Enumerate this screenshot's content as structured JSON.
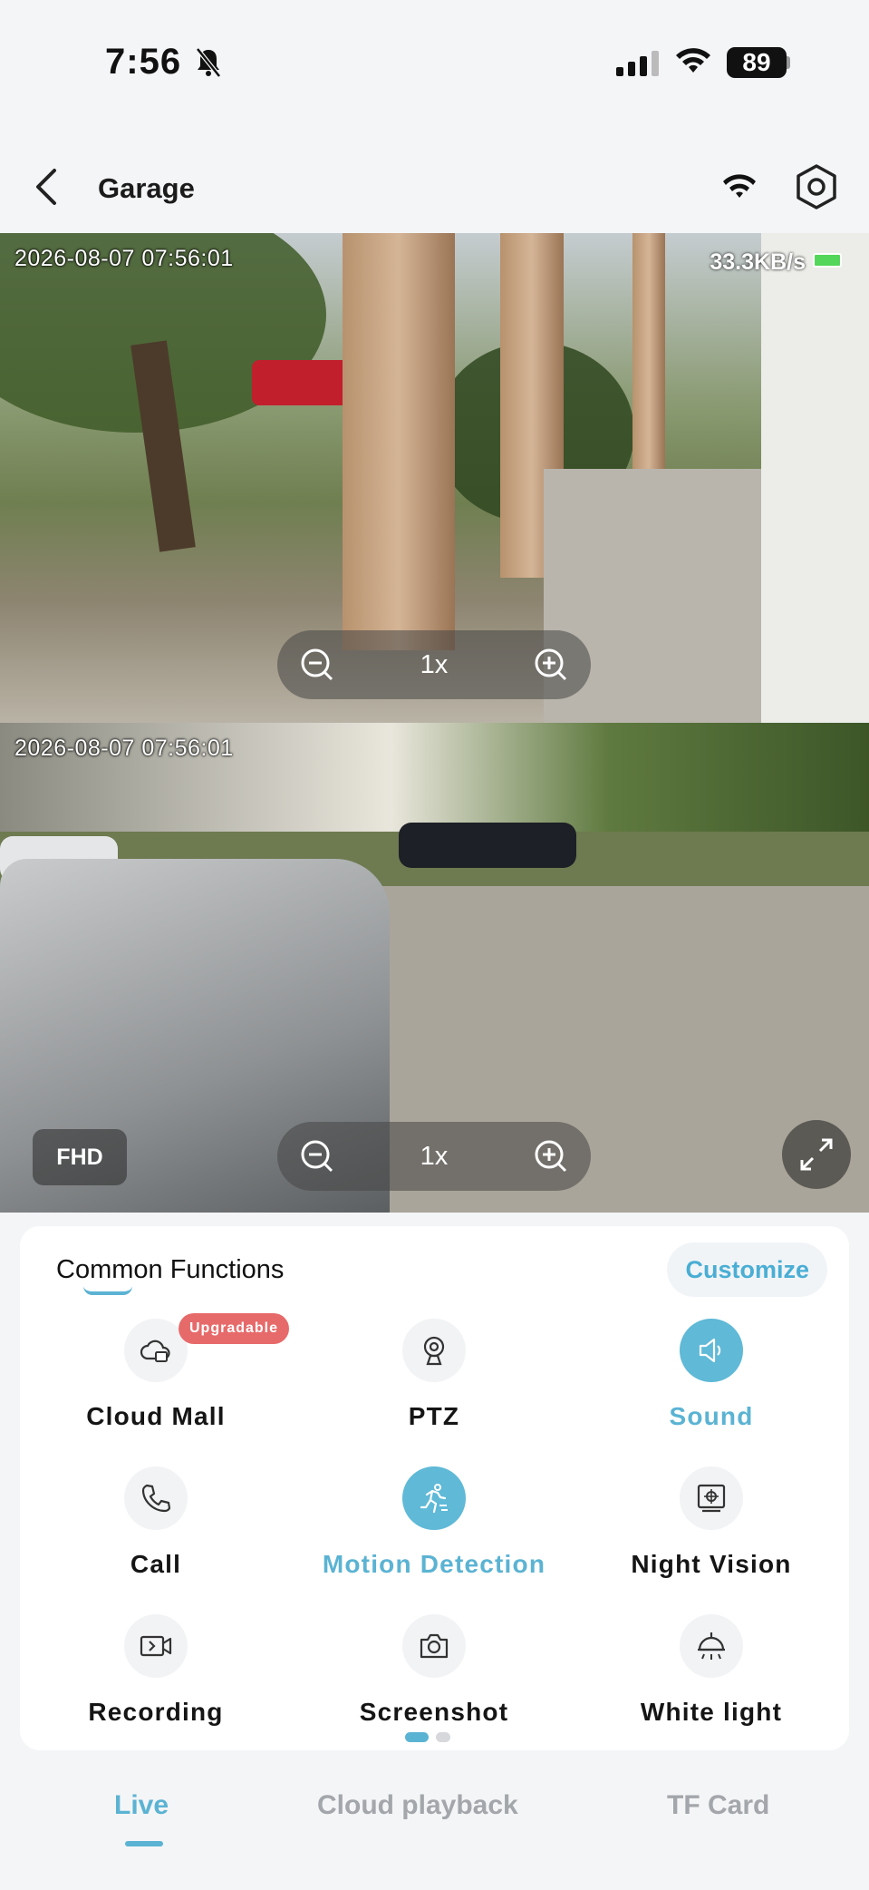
{
  "status_bar": {
    "time": "7:56",
    "battery": "89"
  },
  "header": {
    "title": "Garage"
  },
  "feeds": [
    {
      "timestamp": "2026-08-07 07:56:01",
      "speed": "33.3KB/s",
      "zoom": "1x"
    },
    {
      "timestamp": "2026-08-07 07:56:01",
      "zoom": "1x",
      "quality": "FHD"
    }
  ],
  "functions_panel": {
    "title": "Common Functions",
    "customize_label": "Customize",
    "items": [
      {
        "label": "Cloud Mall",
        "icon": "cloud-icon",
        "badge": "Upgradable",
        "active": false
      },
      {
        "label": "PTZ",
        "icon": "ptz-camera-icon",
        "active": false
      },
      {
        "label": "Sound",
        "icon": "speaker-icon",
        "active": true
      },
      {
        "label": "Call",
        "icon": "phone-icon",
        "active": false
      },
      {
        "label": "Motion Detection",
        "icon": "running-person-icon",
        "active": true
      },
      {
        "label": "Night Vision",
        "icon": "night-vision-icon",
        "active": false
      },
      {
        "label": "Recording",
        "icon": "video-record-icon",
        "active": false
      },
      {
        "label": "Screenshot",
        "icon": "camera-icon",
        "active": false
      },
      {
        "label": "White light",
        "icon": "lamp-icon",
        "active": false
      }
    ],
    "page_count": 2,
    "current_page": 1
  },
  "tabs": [
    {
      "label": "Live",
      "active": true
    },
    {
      "label": "Cloud playback",
      "active": false
    },
    {
      "label": "TF Card",
      "active": false
    }
  ],
  "colors": {
    "accent": "#5bb3d3",
    "badge": "#e76a6a",
    "inactive_tab": "#a3a6aa"
  }
}
